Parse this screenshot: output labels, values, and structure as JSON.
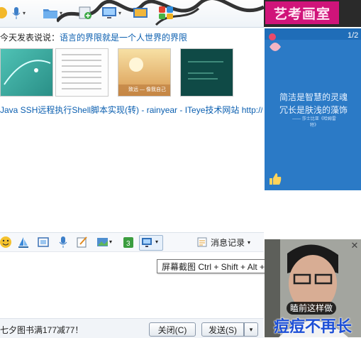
{
  "toolbar": {
    "items": [
      "emoji-icon",
      "microphone-icon",
      "folder-icon",
      "add-file-icon",
      "screen-icon",
      "remote-icon",
      "apps-icon"
    ]
  },
  "banner": {
    "text": "艺考画室"
  },
  "chat": {
    "status_prefix": "今天发表说说：",
    "status_text": "语言的界限就是一个人世界的界限",
    "thumb3_caption": "致远 — 像我自己",
    "link_text": "Java SSH远程执行Shell脚本实现(转) - rainyear - ITeye技术网站 http://u..."
  },
  "right_panel": {
    "page": "1/2",
    "poem_line1": "简洁是智慧的灵魂",
    "poem_line2": "冗长是肤浅的藻饰",
    "poem_credit": "—— 莎士比亚《哈姆雷特》"
  },
  "input_toolbar": {
    "message_log_label": "消息记录",
    "tooltip": "屏幕截图 Ctrl + Shift + Alt + A"
  },
  "bottom": {
    "promo": "七夕图书满177减77！",
    "close_label": "关闭(C)",
    "send_label": "发送(S)"
  },
  "video": {
    "caption": "瞌前这样做",
    "big_text": "痘痘不再长"
  }
}
